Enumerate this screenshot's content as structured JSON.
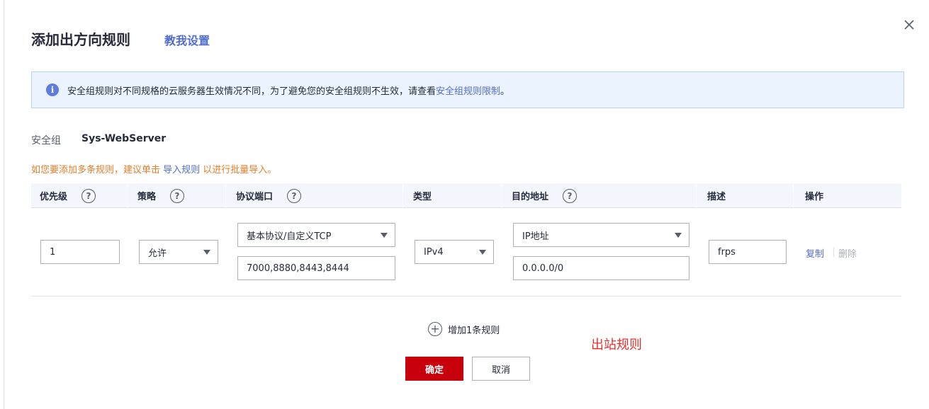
{
  "dialog": {
    "title": "添加出方向规则",
    "guide_link": "教我设置",
    "close_icon": "close-icon"
  },
  "alert": {
    "icon": "info-icon",
    "text": "安全组规则对不同规格的云服务器生效情况不同，为了避免您的安全组规则不生效，请查看",
    "link": "安全组规则限制",
    "suffix": "。"
  },
  "security_group": {
    "label": "安全组",
    "name": "Sys-WebServer"
  },
  "hint": {
    "prefix": "如您要添加多条规则，建议单击 ",
    "link": "导入规则",
    "suffix": " 以进行批量导入。"
  },
  "table": {
    "headers": [
      {
        "label": "优先级",
        "help": true
      },
      {
        "label": "策略",
        "help": true
      },
      {
        "label": "协议端口",
        "help": true
      },
      {
        "label": "类型",
        "help": false
      },
      {
        "label": "目的地址",
        "help": true
      },
      {
        "label": "描述",
        "help": false
      },
      {
        "label": "操作",
        "help": false
      }
    ],
    "row": {
      "priority": "1",
      "policy": "允许",
      "protocol": "基本协议/自定义TCP",
      "ports": "7000,8880,8443,8444",
      "type": "IPv4",
      "dest_type": "IP地址",
      "dest_addr": "0.0.0.0/0",
      "description": "frps",
      "op_copy": "复制",
      "op_delete": "删除"
    }
  },
  "add_rule": {
    "label": "增加1条规则",
    "icon": "plus-circle-icon"
  },
  "annotation": "出站规则",
  "buttons": {
    "ok": "确定",
    "cancel": "取消"
  },
  "colors": {
    "primary_red": "#c7000b",
    "link_blue": "#526ecc",
    "hint_orange": "#e37d29",
    "annotation_red": "#e4312b",
    "alert_bg": "#eaf3ff"
  }
}
